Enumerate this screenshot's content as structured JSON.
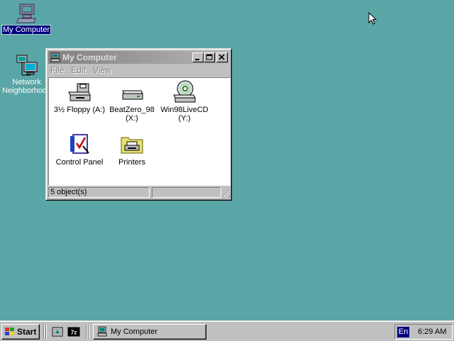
{
  "desktop": {
    "icons": [
      {
        "label": "My Computer"
      },
      {
        "label": "Network Neighborhood"
      }
    ]
  },
  "window": {
    "title": "My Computer",
    "menu": [
      "File",
      "Edit",
      "View"
    ],
    "items": [
      {
        "line1": "3½ Floppy (A:)",
        "line2": ""
      },
      {
        "line1": "BeatZero_98",
        "line2": "(X:)"
      },
      {
        "line1": "Win98LiveCD",
        "line2": "(Y:)"
      },
      {
        "line1": "Control Panel",
        "line2": ""
      },
      {
        "line1": "Printers",
        "line2": ""
      }
    ],
    "status": "5 object(s)"
  },
  "taskbar": {
    "start_label": "Start",
    "task_label": "My Computer",
    "language": "En",
    "clock": "6:29 AM"
  }
}
